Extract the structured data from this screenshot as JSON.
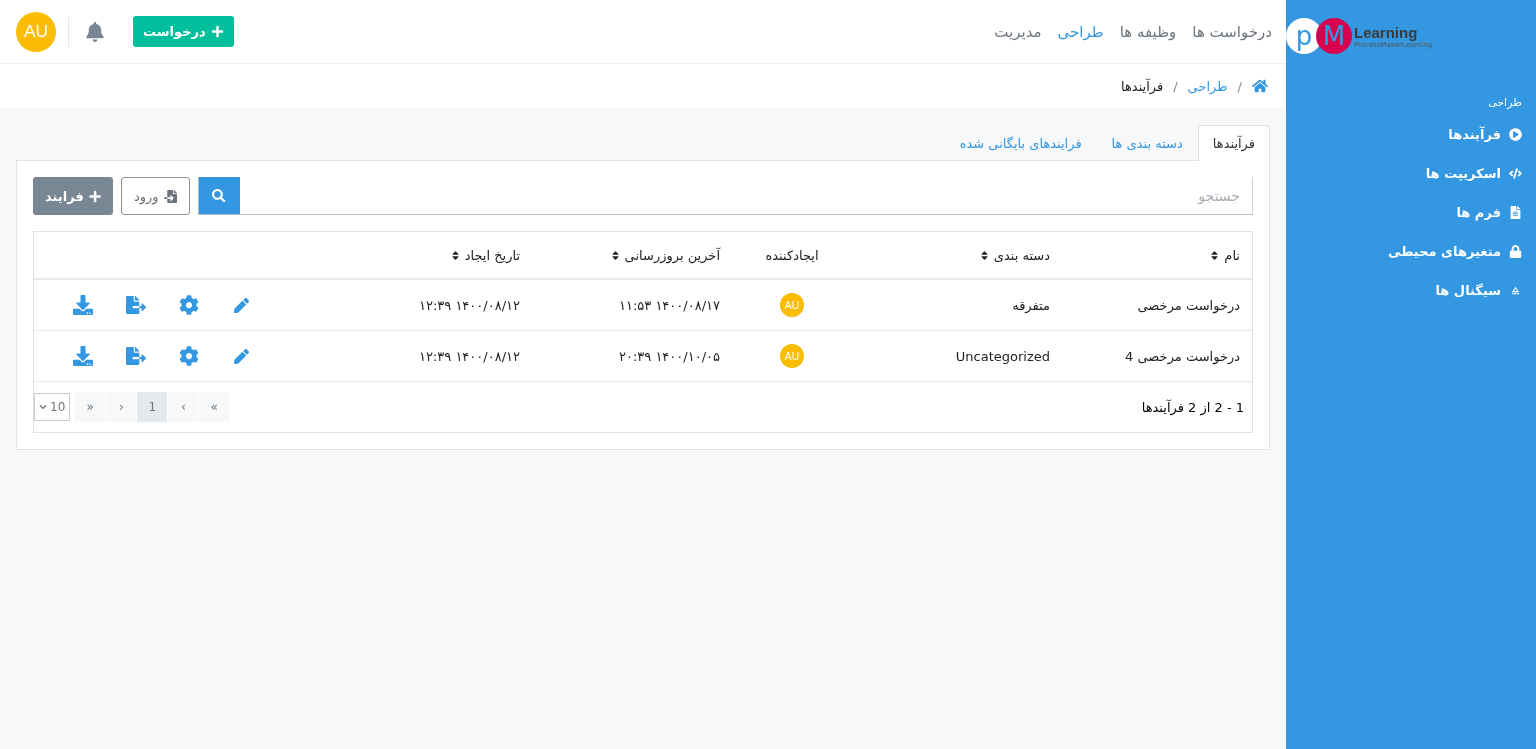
{
  "logo": {
    "letter_1": "p",
    "letter_2": "M",
    "word": "Learning",
    "tagline": "ProcessMakerLearning"
  },
  "sidebar": {
    "section": "طراحی",
    "items": [
      {
        "label": "فرآیندها",
        "kind": "play"
      },
      {
        "label": "اسکریپت ها",
        "kind": "code"
      },
      {
        "label": "فرم ها",
        "kind": "file"
      },
      {
        "label": "متغیرهای محیطی",
        "kind": "lock"
      },
      {
        "label": "سیگنال ها",
        "kind": "signal"
      }
    ]
  },
  "top_nav": [
    {
      "label": "درخواست ها",
      "selected": false
    },
    {
      "label": "وظیفه ها",
      "selected": false
    },
    {
      "label": "طراحی",
      "selected": true
    },
    {
      "label": "مدیریت",
      "selected": false
    }
  ],
  "new_request_button": "درخواست",
  "user_avatar": "AU",
  "breadcrumb": [
    {
      "separator": "/",
      "label": "طراحی",
      "link": true
    },
    {
      "separator": "/",
      "label": "فرآیندها",
      "link": false
    }
  ],
  "tabs": [
    {
      "label": "فرآیندها",
      "selected": true
    },
    {
      "label": "دسته بندی ها",
      "selected": false
    },
    {
      "label": "فرایندهای بایگانی شده",
      "selected": false
    }
  ],
  "search": {
    "placeholder": "جستجو"
  },
  "import_button": "ورود",
  "new_process_button": "فرایند",
  "table": {
    "columns": [
      {
        "label": "نام",
        "sortable": true
      },
      {
        "label": "دسته بندی",
        "sortable": true
      },
      {
        "label": "ایجادکننده",
        "sortable": false
      },
      {
        "label": "آخرین بروزرسانی",
        "sortable": true
      },
      {
        "label": "تاریخ ایجاد",
        "sortable": true
      }
    ],
    "rows": [
      {
        "name": "درخواست مرخصی",
        "category": "متفرقه",
        "creator": "AU",
        "updated": "۱۴۰۰/۰۸/۱۷ ۱۱:۵۳",
        "created": "۱۴۰۰/۰۸/۱۲ ۱۲:۳۹"
      },
      {
        "name": "درخواست مرخصی 4",
        "category": "Uncategorized",
        "creator": "AU",
        "updated": "۱۴۰۰/۱۰/۰۵ ۲۰:۳۹",
        "created": "۱۴۰۰/۰۸/۱۲ ۱۲:۳۹"
      }
    ]
  },
  "summary": "1 - 2 از 2 فرآیندها",
  "pagination": [
    {
      "label": "»",
      "selected": false
    },
    {
      "label": "›",
      "selected": false
    },
    {
      "label": "1",
      "selected": true
    },
    {
      "label": "‹",
      "selected": false
    },
    {
      "label": "«",
      "selected": false
    }
  ],
  "per_page": "10"
}
